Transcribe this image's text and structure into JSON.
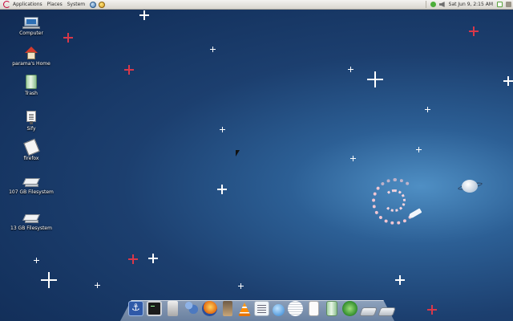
{
  "top_panel": {
    "menus": [
      {
        "label": "Applications"
      },
      {
        "label": "Places"
      },
      {
        "label": "System"
      }
    ],
    "launchers": [
      {
        "icon": "network-launcher-icon"
      },
      {
        "icon": "help-launcher-icon"
      }
    ],
    "clock": "Sat Jun  9,  2:15 AM"
  },
  "desktop": {
    "icons": [
      {
        "label": "Computer",
        "icon": "computer-icon"
      },
      {
        "label": "parama's Home",
        "icon": "home-folder-icon"
      },
      {
        "label": "Trash",
        "icon": "trash-icon"
      },
      {
        "label": "Sify",
        "icon": "network-connection-icon"
      },
      {
        "label": "firefox",
        "icon": "document-icon"
      },
      {
        "label": "107 GB Filesystem",
        "icon": "drive-icon"
      },
      {
        "label": "13 GB Filesystem",
        "icon": "drive-icon"
      }
    ]
  },
  "dock": {
    "items": [
      {
        "icon": "anchor-icon"
      },
      {
        "icon": "terminal-icon"
      },
      {
        "icon": "device-icon"
      },
      {
        "icon": "people-icon"
      },
      {
        "icon": "firefox-icon"
      },
      {
        "icon": "usb-icon"
      },
      {
        "icon": "vlc-icon"
      },
      {
        "icon": "text-document-icon"
      },
      {
        "icon": "globe-document-icon"
      },
      {
        "icon": "disc-icon"
      },
      {
        "icon": "paper-icon"
      },
      {
        "icon": "trash-icon"
      },
      {
        "icon": "green-orb-icon"
      },
      {
        "icon": "drive-icon"
      },
      {
        "icon": "drive-icon"
      }
    ]
  },
  "colors": {
    "desktop_bg": "#1c3f6f",
    "panel_bg": "#e6e3dd",
    "debian_red": "#c70036"
  }
}
